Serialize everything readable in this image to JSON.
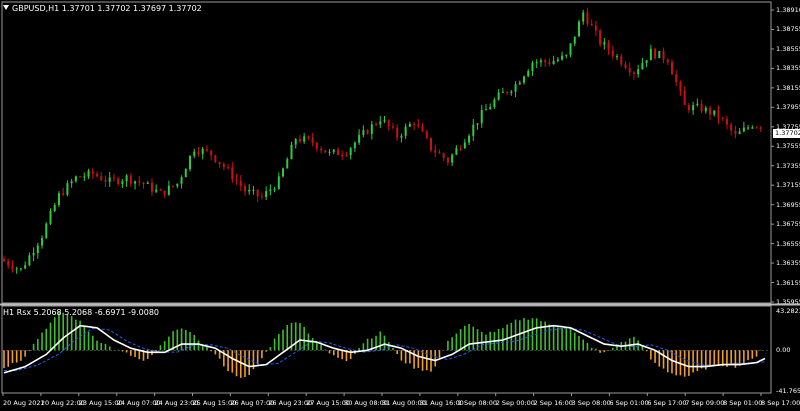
{
  "header": {
    "symbol_info": "GBPUSD,H1  1.37701 1.37702 1.37697 1.37702",
    "indicator_info": "H1 Rsx 5.2068 5.2068 -6.6971 -9.0080"
  },
  "price_axis": {
    "labels": [
      "1.38910",
      "1.38755",
      "1.38555",
      "1.38355",
      "1.38155",
      "1.37955",
      "1.37755",
      "1.37555",
      "1.37355",
      "1.37155",
      "1.36955",
      "1.36755",
      "1.36555",
      "1.36355",
      "1.36155",
      "1.35955"
    ],
    "current_price": "1.37702"
  },
  "indicator_axis": {
    "labels": [
      "43.2823",
      "0.00",
      "-41.7656"
    ]
  },
  "time_axis": {
    "labels": [
      "20 Aug 2021",
      "20 Aug 22:00",
      "23 Aug 15:00",
      "24 Aug 07:00",
      "24 Aug 23:00",
      "25 Aug 15:00",
      "26 Aug 07:00",
      "26 Aug 23:00",
      "27 Aug 15:00",
      "30 Aug 08:00",
      "31 Aug 00:00",
      "31 Aug 16:00",
      "1 Sep 08:00",
      "2 Sep 00:00",
      "2 Sep 16:00",
      "3 Sep 08:00",
      "6 Sep 01:00",
      "6 Sep 17:00",
      "7 Sep 09:00",
      "8 Sep 01:00",
      "8 Sep 17:00"
    ]
  },
  "colors": {
    "bull": "#2ecc40",
    "bear": "#cc1010",
    "hist_up": "#3fbf2a",
    "hist_down": "#f0a020",
    "signal": "#ffffff",
    "blue_line": "#2060ff"
  },
  "chart_data": {
    "type": "candlestick",
    "price_path": [
      [
        0,
        1.3636
      ],
      [
        5,
        1.3625
      ],
      [
        10,
        1.366
      ],
      [
        14,
        1.37
      ],
      [
        18,
        1.3718
      ],
      [
        22,
        1.3722
      ],
      [
        26,
        1.3714
      ],
      [
        30,
        1.3718
      ],
      [
        34,
        1.3712
      ],
      [
        38,
        1.3702
      ],
      [
        42,
        1.3712
      ],
      [
        46,
        1.3748
      ],
      [
        50,
        1.3742
      ],
      [
        54,
        1.3725
      ],
      [
        58,
        1.3705
      ],
      [
        62,
        1.3698
      ],
      [
        66,
        1.3715
      ],
      [
        70,
        1.3758
      ],
      [
        74,
        1.3754
      ],
      [
        78,
        1.3742
      ],
      [
        82,
        1.3745
      ],
      [
        86,
        1.3762
      ],
      [
        90,
        1.3778
      ],
      [
        94,
        1.376
      ],
      [
        98,
        1.3775
      ],
      [
        102,
        1.3748
      ],
      [
        106,
        1.3735
      ],
      [
        110,
        1.3758
      ],
      [
        114,
        1.3782
      ],
      [
        118,
        1.38
      ],
      [
        122,
        1.3812
      ],
      [
        126,
        1.3835
      ],
      [
        130,
        1.3835
      ],
      [
        134,
        1.384
      ],
      [
        138,
        1.3885
      ],
      [
        142,
        1.3855
      ],
      [
        146,
        1.384
      ],
      [
        150,
        1.3825
      ],
      [
        154,
        1.3845
      ],
      [
        158,
        1.3838
      ],
      [
        162,
        1.379
      ],
      [
        166,
        1.3788
      ],
      [
        170,
        1.378
      ],
      [
        174,
        1.376
      ],
      [
        178,
        1.3772
      ],
      [
        180,
        1.377
      ]
    ],
    "indicator": {
      "range": [
        -41.7656,
        43.2823
      ],
      "histogram_path": [
        [
          0,
          -18
        ],
        [
          5,
          -8
        ],
        [
          10,
          20
        ],
        [
          14,
          38
        ],
        [
          18,
          30
        ],
        [
          22,
          12
        ],
        [
          26,
          2
        ],
        [
          30,
          -4
        ],
        [
          34,
          -12
        ],
        [
          38,
          6
        ],
        [
          42,
          24
        ],
        [
          46,
          12
        ],
        [
          50,
          -2
        ],
        [
          54,
          -22
        ],
        [
          58,
          -28
        ],
        [
          62,
          -5
        ],
        [
          66,
          20
        ],
        [
          70,
          30
        ],
        [
          74,
          10
        ],
        [
          78,
          -5
        ],
        [
          82,
          -10
        ],
        [
          86,
          10
        ],
        [
          90,
          18
        ],
        [
          94,
          -8
        ],
        [
          98,
          -18
        ],
        [
          102,
          -20
        ],
        [
          106,
          12
        ],
        [
          110,
          26
        ],
        [
          114,
          16
        ],
        [
          118,
          20
        ],
        [
          122,
          30
        ],
        [
          126,
          32
        ],
        [
          130,
          24
        ],
        [
          134,
          22
        ],
        [
          138,
          8
        ],
        [
          142,
          -4
        ],
        [
          146,
          6
        ],
        [
          150,
          14
        ],
        [
          154,
          -12
        ],
        [
          158,
          -22
        ],
        [
          162,
          -26
        ],
        [
          166,
          -18
        ],
        [
          170,
          -14
        ],
        [
          174,
          -16
        ],
        [
          178,
          -8
        ],
        [
          180,
          4
        ]
      ],
      "signal_path": [
        [
          0,
          -22
        ],
        [
          5,
          -16
        ],
        [
          10,
          -4
        ],
        [
          14,
          12
        ],
        [
          18,
          24
        ],
        [
          22,
          22
        ],
        [
          26,
          10
        ],
        [
          30,
          2
        ],
        [
          34,
          -2
        ],
        [
          38,
          -2
        ],
        [
          42,
          6
        ],
        [
          46,
          6
        ],
        [
          50,
          2
        ],
        [
          54,
          -8
        ],
        [
          58,
          -16
        ],
        [
          62,
          -14
        ],
        [
          66,
          -2
        ],
        [
          70,
          10
        ],
        [
          74,
          8
        ],
        [
          78,
          2
        ],
        [
          82,
          -2
        ],
        [
          86,
          0
        ],
        [
          90,
          6
        ],
        [
          94,
          2
        ],
        [
          98,
          -6
        ],
        [
          102,
          -10
        ],
        [
          106,
          -4
        ],
        [
          110,
          6
        ],
        [
          114,
          8
        ],
        [
          118,
          10
        ],
        [
          122,
          16
        ],
        [
          126,
          22
        ],
        [
          130,
          24
        ],
        [
          134,
          22
        ],
        [
          138,
          14
        ],
        [
          142,
          6
        ],
        [
          146,
          4
        ],
        [
          150,
          6
        ],
        [
          154,
          0
        ],
        [
          158,
          -10
        ],
        [
          162,
          -16
        ],
        [
          166,
          -16
        ],
        [
          170,
          -14
        ],
        [
          174,
          -14
        ],
        [
          178,
          -12
        ],
        [
          180,
          -8
        ]
      ]
    }
  }
}
